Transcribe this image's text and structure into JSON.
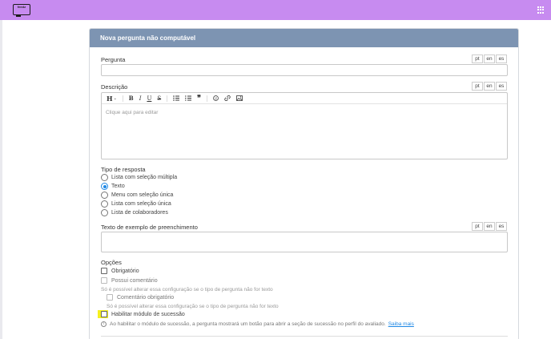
{
  "header": {
    "logo_text": "feedz",
    "apps_icon": "grid-icon"
  },
  "form": {
    "title": "Nova pergunta não computável",
    "languages": [
      "pt",
      "en",
      "es"
    ],
    "question_label": "Pergunta",
    "question_value": "",
    "description_label": "Descrição",
    "editor_placeholder": "Clique aqui para editar",
    "editor_toolbar": [
      "heading-icon",
      "bold-icon",
      "italic-icon",
      "underline-icon",
      "strikethrough-icon",
      "bullet-list-icon",
      "numbered-list-icon",
      "quote-icon",
      "emoji-icon",
      "link-icon",
      "image-icon"
    ],
    "response_type_label": "Tipo de resposta",
    "response_types": [
      {
        "label": "Lista com seleção múltipla",
        "checked": false
      },
      {
        "label": "Texto",
        "checked": true
      },
      {
        "label": "Menu com seleção única",
        "checked": false
      },
      {
        "label": "Lista com seleção única",
        "checked": false
      },
      {
        "label": "Lista de colaboradores",
        "checked": false
      }
    ],
    "example_text_label": "Texto de exemplo de preenchimento",
    "example_text_value": "",
    "options_label": "Opções",
    "options": {
      "required": "Obrigatório",
      "has_comment": "Possui comentário",
      "has_comment_hint": "Só é possível alterar essa configuração se o tipo de pergunta não for texto",
      "comment_required": "Comentário obrigatório",
      "comment_required_hint": "Só é possível alterar essa configuração se o tipo de pergunta não for texto",
      "succession": "Habilitar módulo de sucessão"
    },
    "succession_info": "Ao habilitar o módulo de sucessão, a pergunta mostrará um botão para abrir a seção de sucessão no perfil do avaliado.",
    "succession_link": "Saiba mais"
  },
  "colors": {
    "topbar": "#c78bf0",
    "card_header": "#7d94b2",
    "accent": "#1e88e5",
    "highlight": "#f5f01e"
  }
}
